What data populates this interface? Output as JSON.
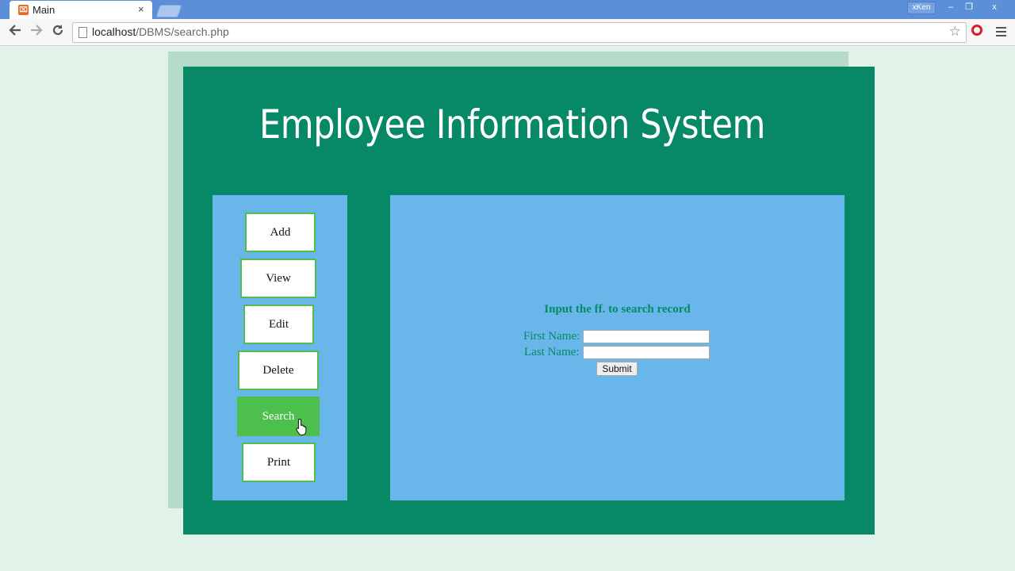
{
  "browser": {
    "tab_title": "Main",
    "tab_close": "×",
    "user_name": "xKen",
    "url_host": "localhost",
    "url_path": "/DBMS/search.php",
    "window_buttons": {
      "minimize": "–",
      "restore": "❐",
      "close": "x"
    },
    "icons": {
      "back": "back-arrow-icon",
      "forward": "forward-arrow-icon",
      "reload": "reload-icon",
      "bookmark": "star-icon",
      "menu": "hamburger-menu-icon"
    }
  },
  "page": {
    "title": "Employee Information System",
    "menu": [
      {
        "label": "Add"
      },
      {
        "label": "View"
      },
      {
        "label": "Edit"
      },
      {
        "label": "Delete"
      },
      {
        "label": "Search",
        "active": true
      },
      {
        "label": "Print"
      }
    ],
    "search": {
      "heading": "Input the ff. to search record",
      "first_name_label": "First Name:",
      "first_name_value": "",
      "last_name_label": "Last Name:",
      "last_name_value": "",
      "submit_label": "Submit"
    },
    "colors": {
      "page_bg": "#e1f3e9",
      "panel_green": "#078866",
      "panel_blue": "#69b7ea",
      "active_button": "#4cbf4c"
    }
  }
}
